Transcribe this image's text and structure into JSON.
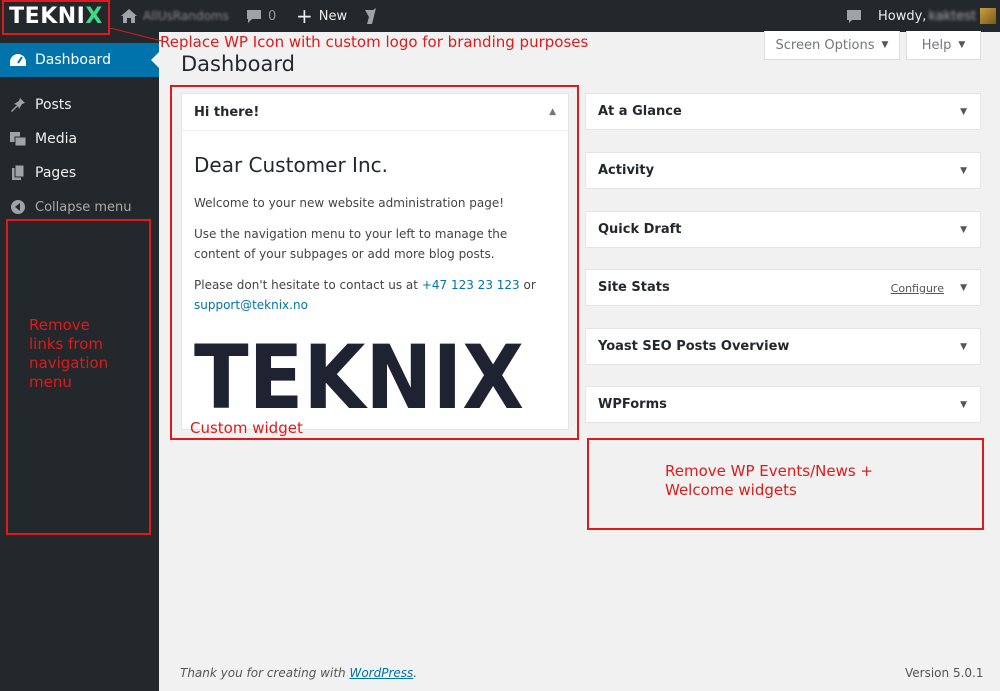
{
  "adminbar": {
    "logo_text": "TEKNI",
    "logo_x": "X",
    "site_name": "AllUsRandoms",
    "comments_count": "0",
    "new_label": "New",
    "howdy": "Howdy,",
    "username": "kaktest"
  },
  "sidebar": {
    "items": [
      {
        "label": "Dashboard",
        "icon": "dashboard-icon"
      },
      {
        "label": "Posts",
        "icon": "pin-icon"
      },
      {
        "label": "Media",
        "icon": "media-icon"
      },
      {
        "label": "Pages",
        "icon": "pages-icon"
      }
    ],
    "collapse_label": "Collapse menu"
  },
  "header": {
    "screen_options": "Screen Options",
    "help": "Help",
    "title": "Dashboard"
  },
  "custom_widget": {
    "title": "Hi there!",
    "greeting": "Dear Customer Inc.",
    "p1": "Welcome to your new website administration page!",
    "p2": "Use the navigation menu to your left to manage the content of your subpages or add more blog posts.",
    "p3_prefix": "Please don't hesitate to contact us at",
    "phone": "+47 123 23 123",
    "p3_or": "or",
    "email": "support@teknix.no",
    "logo_text": "TEKNIX"
  },
  "right_widgets": {
    "at_a_glance": "At a Glance",
    "activity": "Activity",
    "quick_draft": "Quick Draft",
    "site_stats": "Site Stats",
    "configure": "Configure",
    "yoast": "Yoast SEO Posts Overview",
    "wpforms": "WPForms"
  },
  "annotations": {
    "logo_note": "Replace WP Icon with custom logo for branding purposes",
    "nav_note_1": "Remove",
    "nav_note_2": "links from",
    "nav_note_3": "navigation",
    "nav_note_4": "menu",
    "custom_widget_note": "Custom widget",
    "events_note_1": "Remove WP Events/News +",
    "events_note_2": "Welcome widgets",
    "color": "#e01a1a"
  },
  "footer": {
    "thanks_prefix": "Thank you for creating with",
    "wordpress": "WordPress",
    "thanks_suffix": ".",
    "version": "Version 5.0.1"
  }
}
